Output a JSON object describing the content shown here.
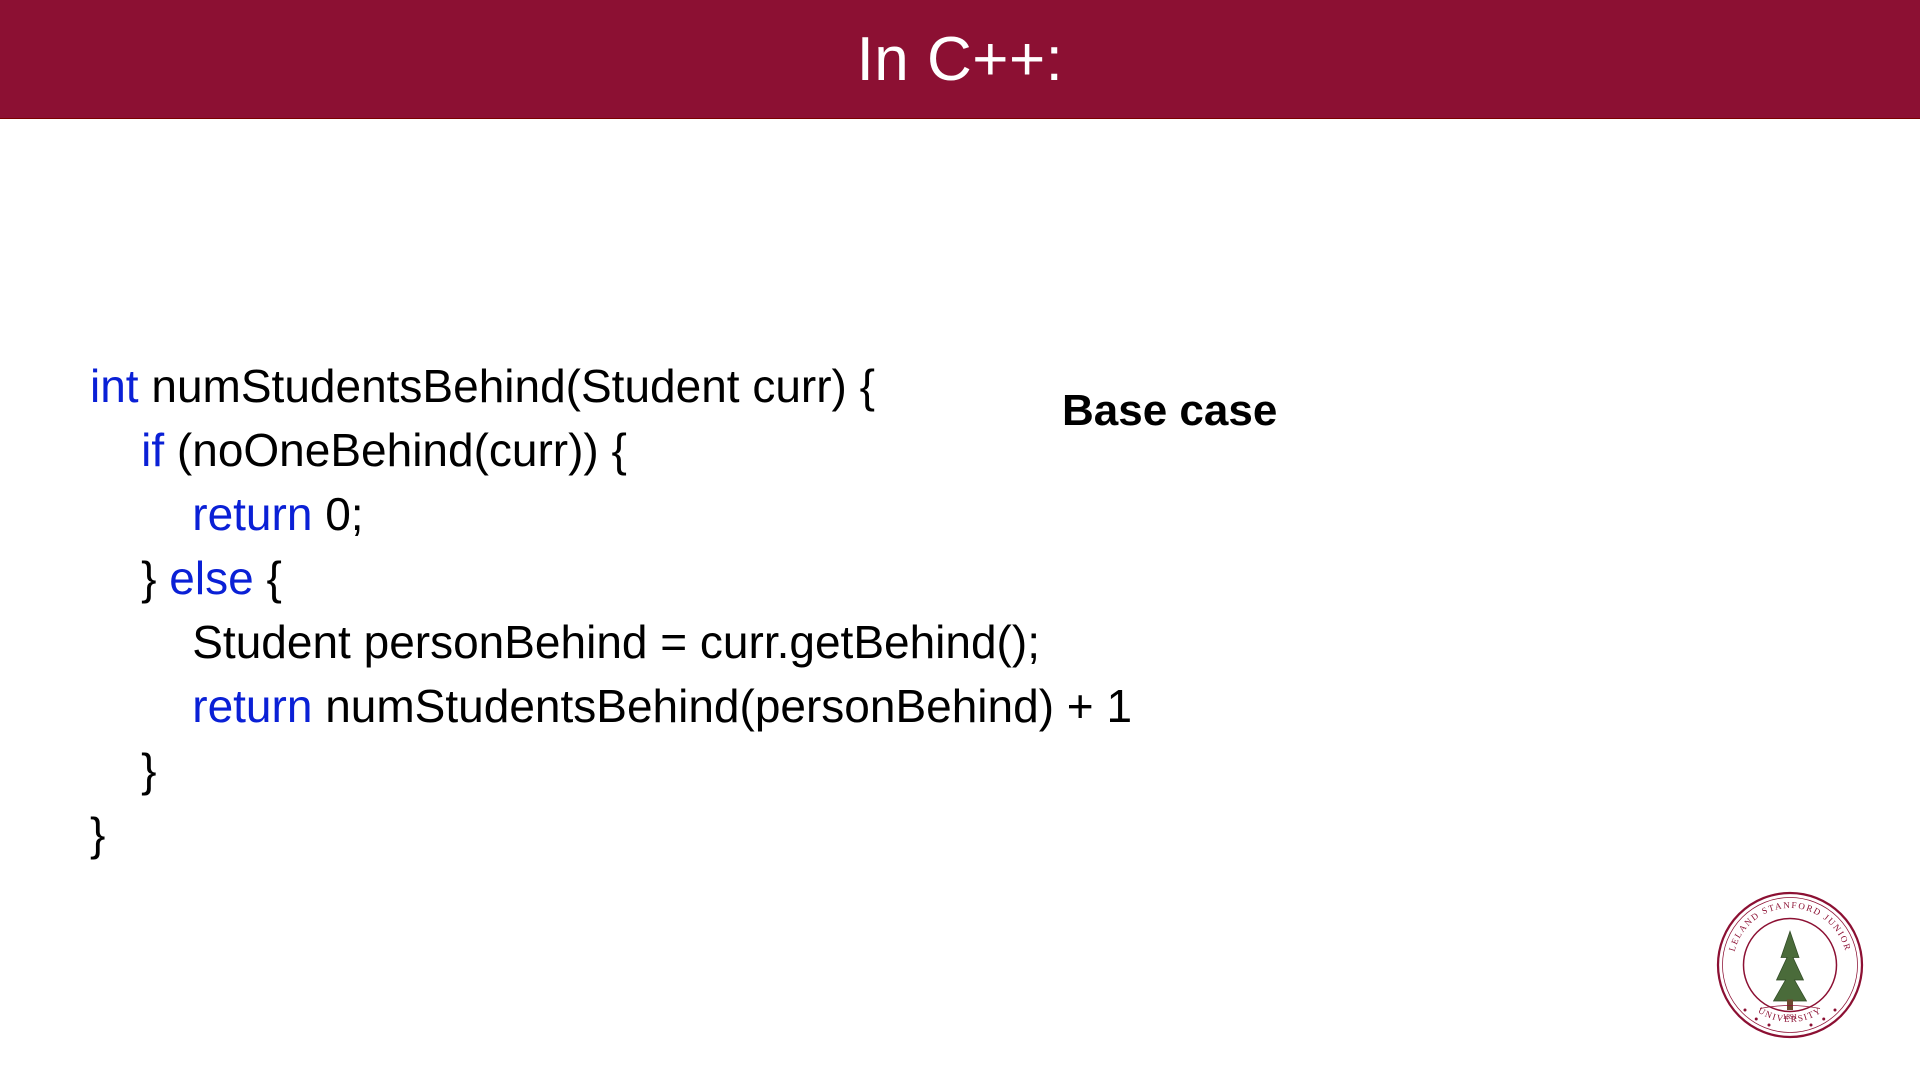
{
  "title": "In C++:",
  "annotation": "Base case",
  "code": {
    "l1": {
      "int": "int",
      "rest": " numStudentsBehind(Student curr) {"
    },
    "l2": {
      "indent": "    ",
      "if": "if",
      "paren": " (",
      "cond": "noOneBehind(curr)) {"
    },
    "l3": {
      "indent": "        ",
      "ret": "return",
      "rest": " 0;"
    },
    "l4": {
      "indent": "    ",
      "close": "} ",
      "else": "else",
      "open": " {"
    },
    "l5": {
      "indent": "        ",
      "text": "Student personBehind = curr.getBehind();"
    },
    "l6": {
      "indent": "        ",
      "ret": "return",
      "rest": " numStudentsBehind(personBehind) + 1"
    },
    "l7": {
      "indent": "    ",
      "close": "}"
    },
    "l8": {
      "close": "}"
    }
  },
  "seal": {
    "top": "LELAND STANFORD JUNIOR",
    "bottom": "UNIVERSITY",
    "year": "1891"
  }
}
